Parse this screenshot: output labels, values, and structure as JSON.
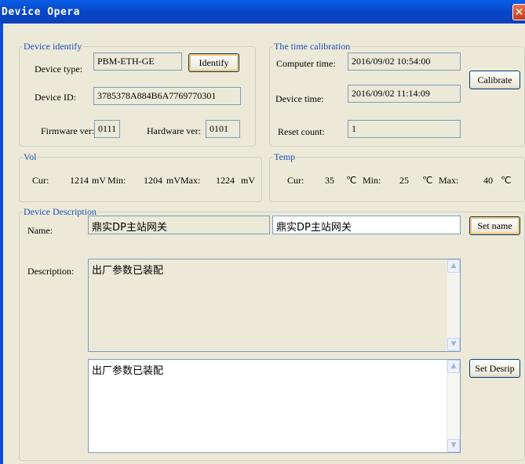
{
  "window": {
    "title": "Device Opera",
    "close_glyph": "✕"
  },
  "identify": {
    "legend": "Device identify",
    "type_label": "Device type:",
    "type_value": "PBM-ETH-GE",
    "identify_button": "Identify",
    "id_label": "Device ID:",
    "id_value": "3785378A884B6A7769770301",
    "fw_label": "Firmware ver:",
    "fw_value": "0111",
    "hw_label": "Hardware ver:",
    "hw_value": "0101"
  },
  "calibration": {
    "legend": "The time calibration",
    "computer_label": "Computer time:",
    "computer_value": "2016/09/02 10:54:00",
    "device_label": "Device time:",
    "device_value": "2016/09/02 11:14:09",
    "calibrate_button": "Calibrate",
    "reset_label": "Reset count:",
    "reset_value": "1"
  },
  "vol": {
    "legend": "Vol",
    "cur_label": "Cur:",
    "cur_value": "1214",
    "cur_unit": "mV",
    "min_label": "Min:",
    "min_value": "1204",
    "min_unit": "mV",
    "max_label": "Max:",
    "max_value": "1224",
    "max_unit": "mV"
  },
  "temp": {
    "legend": "Temp",
    "cur_label": "Cur:",
    "cur_value": "35",
    "cur_unit": "℃",
    "min_label": "Min:",
    "min_value": "25",
    "min_unit": "℃",
    "max_label": "Max:",
    "max_value": "40",
    "max_unit": "℃"
  },
  "description": {
    "legend": "Device Description",
    "name_label": "Name:",
    "name_current": "鼎实DP主站网关",
    "name_input": "鼎实DP主站网关",
    "set_name_button": "Set name",
    "desc_label": "Description:",
    "desc_current": "出厂参数已装配",
    "desc_input": "出厂参数已装配",
    "set_desc_button": "Set Desrip"
  },
  "icons": {
    "scroll_up": "▲",
    "scroll_down": "▼"
  }
}
